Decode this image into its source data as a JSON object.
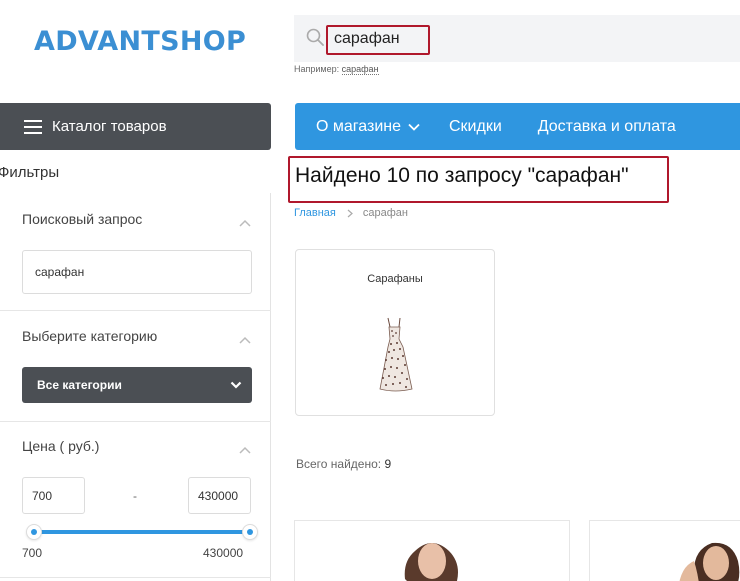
{
  "header": {
    "logo": "ADVANTSHOP",
    "search": {
      "value": "сарафан",
      "placeholder": ""
    },
    "example_label": "Например:",
    "example_link": "сарафан"
  },
  "catalog_button": {
    "label": "Каталог товаров"
  },
  "nav": {
    "items": [
      "О магазине",
      "Скидки",
      "Доставка и оплата"
    ]
  },
  "filters": {
    "title": "Фильтры",
    "search_query": {
      "title": "Поисковый запрос",
      "value": "сарафан"
    },
    "category": {
      "title": "Выберите категорию",
      "selected": "Все категории"
    },
    "price": {
      "title": "Цена ( руб.)",
      "min": "700",
      "max": "430000",
      "range_min_label": "700",
      "range_max_label": "430000",
      "dash": "-"
    }
  },
  "results": {
    "heading": "Найдено 10 по запросу \"сарафан\"",
    "breadcrumb": {
      "home": "Главная",
      "current": "сарафан"
    },
    "category_card": {
      "name": "Сарафаны"
    },
    "total_label": "Всего найдено:",
    "total_count": "9"
  },
  "colors": {
    "brand": "#3b8fd3",
    "nav": "#2f96e0",
    "dark": "#4b4f54",
    "highlight": "#b0182c"
  }
}
